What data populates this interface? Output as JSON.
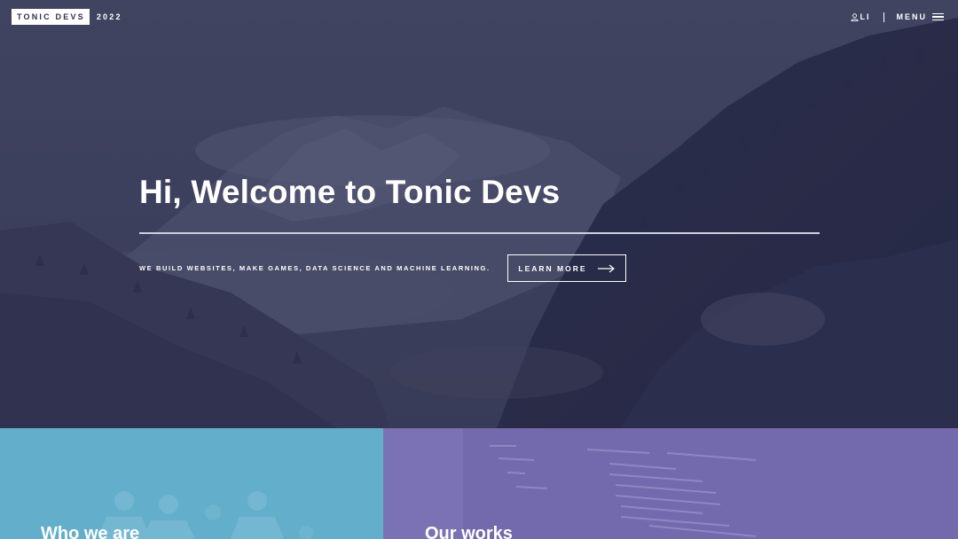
{
  "header": {
    "logo_text": "TONIC DEVS",
    "logo_year": "2022",
    "login_label": "LI",
    "menu_label": "MENU",
    "icons": {
      "user": "user-icon",
      "menu": "hamburger-icon"
    }
  },
  "hero": {
    "title": "Hi, Welcome to Tonic Devs",
    "tagline": "WE BUILD WEBSITES, MAKE GAMES, DATA SCIENCE AND MACHINE LEARNING.",
    "cta_label": "LEARN MORE",
    "cta_icon": "arrow-right-icon"
  },
  "panels": {
    "who": {
      "title": "Who we are",
      "color": "#63aecb"
    },
    "works": {
      "title": "Our works",
      "color": "#7b71b5"
    }
  },
  "colors": {
    "hero_overlay": "#3c3f58",
    "logo_box_bg": "#ffffff"
  }
}
